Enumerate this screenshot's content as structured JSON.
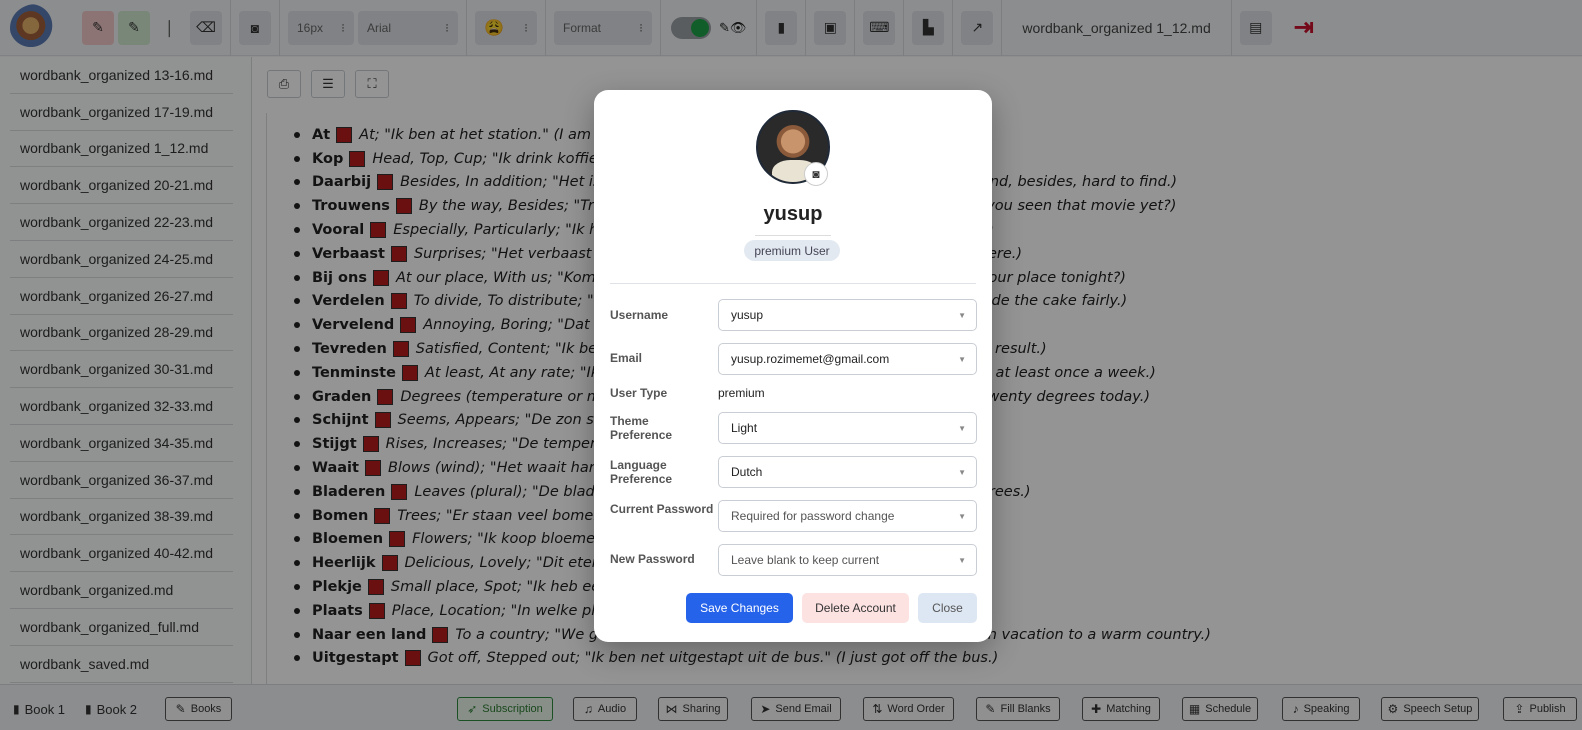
{
  "toolbar": {
    "font_size": "16px",
    "font_family": "Arial",
    "emoji": "😩",
    "format": "Format",
    "doc_title": "wordbank_organized 1_12.md"
  },
  "sidebar": {
    "items": [
      "wordbank_organized 13-16.md",
      "wordbank_organized 17-19.md",
      "wordbank_organized 1_12.md",
      "wordbank_organized 20-21.md",
      "wordbank_organized 22-23.md",
      "wordbank_organized 24-25.md",
      "wordbank_organized 26-27.md",
      "wordbank_organized 28-29.md",
      "wordbank_organized 30-31.md",
      "wordbank_organized 32-33.md",
      "wordbank_organized 34-35.md",
      "wordbank_organized 36-37.md",
      "wordbank_organized 38-39.md",
      "wordbank_organized 40-42.md",
      "wordbank_organized.md",
      "wordbank_organized_full.md",
      "wordbank_saved.md"
    ]
  },
  "words": [
    {
      "w": "At",
      "d": "At; \"Ik ben at het station.\" (I am at the station.)"
    },
    {
      "w": "Kop",
      "d": "Head, Top, Cup; \"Ik drink koffie uit een kop.\" (I drink coffee from a cup.)"
    },
    {
      "w": "Daarbij",
      "d": "Besides, In addition; \"Het is duur en daarbij moeilijk te vinden.\" (It is expensive and, besides, hard to find.)"
    },
    {
      "w": "Trouwens",
      "d": "By the way, Besides; \"Trouwens, heb je die film al gezien?\" (By the way, have you seen that movie yet?)"
    },
    {
      "w": "Vooral",
      "d": "Especially, Particularly; \"Ik hou vooral van chocolade.\" (I especially like chocolate.)"
    },
    {
      "w": "Verbaast",
      "d": "Surprises; \"Het verbaast me dat hij er niet is.\" (It surprises me that he is not there.)"
    },
    {
      "w": "Bij ons",
      "d": "At our place, With us; \"Kom je vanavond bij ons eten?\" (Are you coming to eat at our place tonight?)"
    },
    {
      "w": "Verdelen",
      "d": "To divide, To distribute; \"We moeten de taart eerlijk verdelen.\" (We have to divide the cake fairly.)"
    },
    {
      "w": "Vervelend",
      "d": "Annoying, Boring; \"Dat is erg vervelend.\" (That is very annoying.)"
    },
    {
      "w": "Tevreden",
      "d": "Satisfied, Content; \"Ik ben tevreden met het resultaat.\" (I am satisfied with the result.)"
    },
    {
      "w": "Tenminste",
      "d": "At least, At any rate; \"Ik ga tenminste een keer per week sporten.\" (I exercise at least once a week.)"
    },
    {
      "w": "Graden",
      "d": "Degrees (temperature or measurement); \"Het is vandaag twintig graden.\" (It is twenty degrees today.)"
    },
    {
      "w": "Schijnt",
      "d": "Seems, Appears; \"De zon schijnt vandaag.\" (The sun is shining today.)"
    },
    {
      "w": "Stijgt",
      "d": "Rises, Increases; \"De temperatuur stijgt snel.\" (The temperature rises quickly.)"
    },
    {
      "w": "Waait",
      "d": "Blows (wind); \"Het waait hard vandaag.\" (It is very windy today.)"
    },
    {
      "w": "Bladeren",
      "d": "Leaves (plural); \"De bladeren vallen van de bomen.\" (The leaves fall from the trees.)"
    },
    {
      "w": "Bomen",
      "d": "Trees; \"Er staan veel bomen in het park.\" (There are many trees in the park.)"
    },
    {
      "w": "Bloemen",
      "d": "Flowers; \"Ik koop bloemen voor mijn moeder.\" (I buy flowers for my mother.)"
    },
    {
      "w": "Heerlijk",
      "d": "Delicious, Lovely; \"Dit eten is heerlijk.\" (This food is delicious.)"
    },
    {
      "w": "Plekje",
      "d": "Small place, Spot; \"Ik heb een leuk plekje gevonden.\" (I found a nice spot.)"
    },
    {
      "w": "Plaats",
      "d": "Place, Location; \"In welke plaats woon je?\" (In which place do you live?)"
    },
    {
      "w": "Naar een land",
      "d": "To a country; \"We gaan op vakantie naar een warm land.\" (We're going on vacation to a warm country.)"
    },
    {
      "w": "Uitgestapt",
      "d": "Got off, Stepped out; \"Ik ben net uitgestapt uit de bus.\" (I just got off the bus.)"
    }
  ],
  "bottombar": {
    "book1": "Book 1",
    "book2": "Book 2",
    "items": [
      "Books",
      "Subscription",
      "Audio",
      "Sharing",
      "Send Email",
      "Word Order",
      "Fill Blanks",
      "Matching",
      "Schedule",
      "Speaking",
      "Speech Setup",
      "Publish"
    ]
  },
  "modal": {
    "name": "yusup",
    "badge": "premium User",
    "fields": {
      "username_label": "Username",
      "username_value": "yusup",
      "email_label": "Email",
      "email_value": "yusup.rozimemet@gmail.com",
      "usertype_label": "User Type",
      "usertype_value": "premium",
      "theme_label": "Theme Preference",
      "theme_value": "Light",
      "language_label": "Language Preference",
      "language_value": "Dutch",
      "current_pw_label": "Current Password",
      "current_pw_placeholder": "Required for password change",
      "new_pw_label": "New Password",
      "new_pw_placeholder": "Leave blank to keep current"
    },
    "buttons": {
      "save": "Save Changes",
      "delete": "Delete Account",
      "close": "Close"
    }
  },
  "colors": {
    "accent": "#2563eb",
    "exit": "#c8102e",
    "word_marker": "#b71c1c",
    "toggle_on": "#1fa34a"
  }
}
